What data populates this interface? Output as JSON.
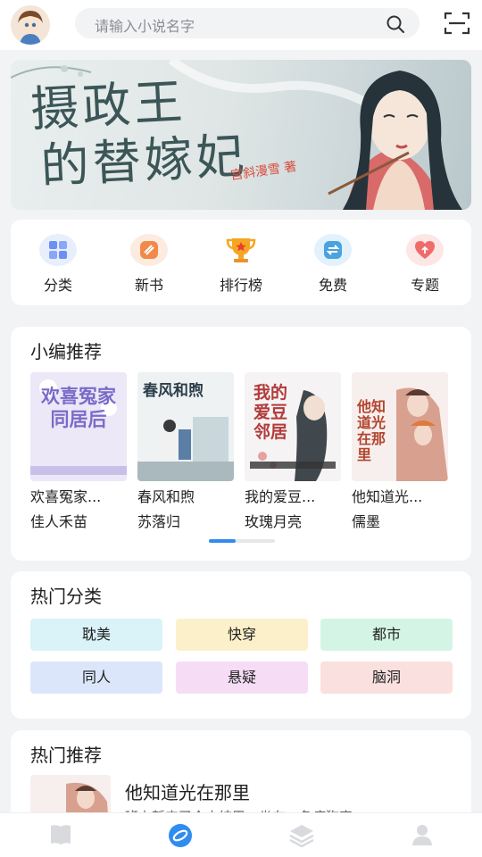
{
  "search": {
    "placeholder": "请输入小说名字"
  },
  "banner": {
    "title_line1": "摄政王",
    "title_line2": "的替嫁妃",
    "author": "宫斜漫雪 著"
  },
  "quick_nav": [
    {
      "label": "分类",
      "icon": "grid-icon",
      "color": "#6c8ff5"
    },
    {
      "label": "新书",
      "icon": "new-book-icon",
      "color": "#f08a4b"
    },
    {
      "label": "排行榜",
      "icon": "trophy-icon",
      "color": "#f5a623"
    },
    {
      "label": "免费",
      "icon": "free-swap-icon",
      "color": "#4aa3df"
    },
    {
      "label": "专题",
      "icon": "heart-icon",
      "color": "#f06b6b"
    }
  ],
  "editor_picks": {
    "title": "小编推荐",
    "books": [
      {
        "title": "欢喜冤家...",
        "author": "佳人禾苗",
        "cover_text": "欢喜冤家同居后"
      },
      {
        "title": "春风和煦",
        "author": "苏落归",
        "cover_text": "春风和煦"
      },
      {
        "title": "我的爱豆...",
        "author": "玫瑰月亮",
        "cover_text": "我的爱豆邻居"
      },
      {
        "title": "他知道光...",
        "author": "儒墨",
        "cover_text": "他知道光在那里"
      }
    ]
  },
  "hot_categories": {
    "title": "热门分类",
    "tags": [
      {
        "label": "耽美",
        "color": "#d9f3f8"
      },
      {
        "label": "快穿",
        "color": "#fbf0c9"
      },
      {
        "label": "都市",
        "color": "#d4f5e6"
      },
      {
        "label": "同人",
        "color": "#dbe6fb"
      },
      {
        "label": "悬疑",
        "color": "#f6ddf5"
      },
      {
        "label": "脑洞",
        "color": "#fbe0e0"
      }
    ]
  },
  "hot_recommend": {
    "title": "热门推荐",
    "item": {
      "title": "他知道光在那里",
      "desc": "班上新来了个小结巴，坐在一条病狗旁"
    }
  },
  "bottom_nav": [
    {
      "name": "bookshelf-icon"
    },
    {
      "name": "discover-icon",
      "active": true,
      "color": "#2f8cf0"
    },
    {
      "name": "category-layers-icon"
    },
    {
      "name": "profile-icon"
    }
  ]
}
